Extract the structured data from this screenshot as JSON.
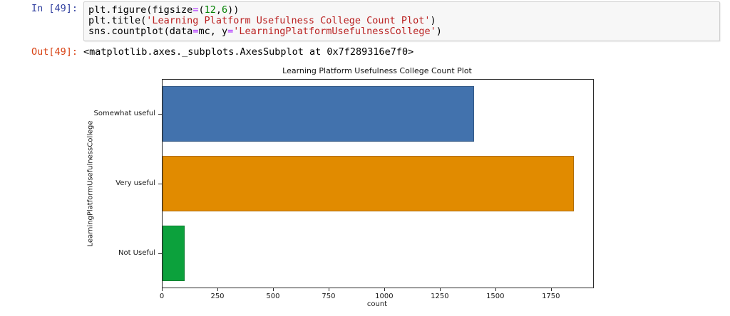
{
  "cell": {
    "input_prompt": "In [49]:",
    "output_prompt": "Out[49]:",
    "output_text": "<matplotlib.axes._subplots.AxesSubplot at 0x7f289316e7f0>",
    "code_lines": [
      [
        {
          "t": "plt.figure(figsize",
          "c": "p"
        },
        {
          "t": "=",
          "c": "o"
        },
        {
          "t": "(",
          "c": "p"
        },
        {
          "t": "12",
          "c": "n"
        },
        {
          "t": ",",
          "c": "p"
        },
        {
          "t": "6",
          "c": "n"
        },
        {
          "t": "))",
          "c": "p"
        }
      ],
      [
        {
          "t": "plt.title(",
          "c": "p"
        },
        {
          "t": "'Learning Platform Usefulness College Count Plot'",
          "c": "s"
        },
        {
          "t": ")",
          "c": "p"
        }
      ],
      [
        {
          "t": "sns.countplot(data",
          "c": "p"
        },
        {
          "t": "=",
          "c": "o"
        },
        {
          "t": "mc, y",
          "c": "p"
        },
        {
          "t": "=",
          "c": "o"
        },
        {
          "t": "'LearningPlatformUsefulnessCollege'",
          "c": "s"
        },
        {
          "t": ")",
          "c": "p"
        }
      ]
    ]
  },
  "syntax_colors": {
    "p": "#000000",
    "o": "#aa22ff",
    "n": "#008000",
    "s": "#ba2121"
  },
  "ui_colors": {
    "in_prompt": "#303f9f",
    "out_prompt": "#d84315",
    "code_box_bg": "#f7f7f7",
    "code_box_border": "#cfcfcf",
    "axes_spine": "#2b2b2b"
  },
  "chart_data": {
    "type": "bar",
    "orientation": "horizontal",
    "title": "Learning Platform Usefulness College Count Plot",
    "xlabel": "count",
    "ylabel": "LearningPlatformUsefulnessCollege",
    "categories": [
      "Somewhat useful",
      "Very useful",
      "Not Useful"
    ],
    "values": [
      1400,
      1850,
      100
    ],
    "bar_colors": [
      "#4272ad",
      "#e18b00",
      "#0ca13c"
    ],
    "xticks": [
      0,
      250,
      500,
      750,
      1000,
      1250,
      1500,
      1750
    ],
    "xlim": [
      0,
      1943
    ],
    "grid": false,
    "legend": null
  }
}
